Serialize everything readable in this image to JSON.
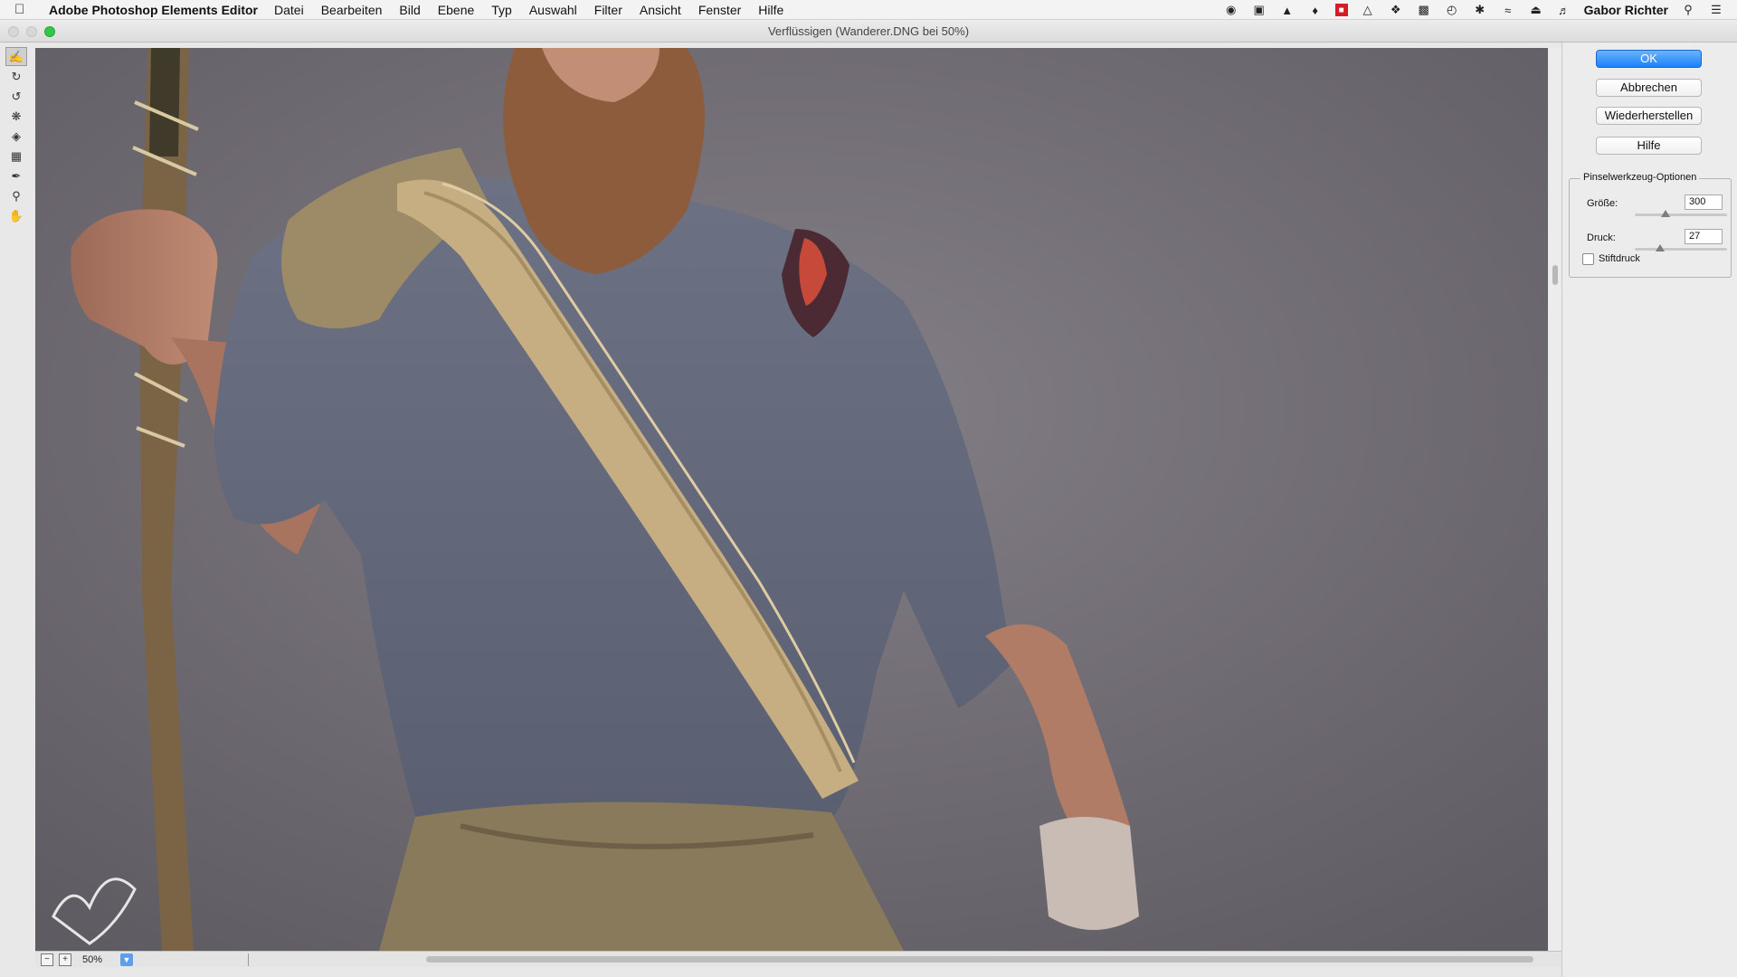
{
  "menubar": {
    "app_name": "Adobe Photoshop Elements Editor",
    "items": [
      "Datei",
      "Bearbeiten",
      "Bild",
      "Ebene",
      "Typ",
      "Auswahl",
      "Filter",
      "Ansicht",
      "Fenster",
      "Hilfe"
    ],
    "user": "Gabor Richter",
    "status_icons": [
      "record-icon",
      "display-icon",
      "airplay-icon",
      "evernote-icon",
      "red-app-icon",
      "drive-icon",
      "dropbox-icon",
      "monitor-icon",
      "time-machine-icon",
      "bluetooth-icon",
      "wifi-icon",
      "eject-icon",
      "volume-icon",
      "spotlight-icon",
      "notification-list-icon"
    ]
  },
  "window": {
    "title": "Verflüssigen (Wanderer.DNG bei 50%)"
  },
  "toolbox": {
    "tools": [
      "warp-tool-icon",
      "twirl-clockwise-icon",
      "twirl-counterclockwise-icon",
      "pucker-tool-icon",
      "bloat-tool-icon",
      "shift-pixels-icon",
      "reconstruct-tool-icon",
      "zoom-tool-icon",
      "hand-tool-icon"
    ]
  },
  "buttons": {
    "ok": "OK",
    "cancel": "Abbrechen",
    "restore": "Wiederherstellen",
    "help": "Hilfe"
  },
  "brush_options": {
    "title": "Pinselwerkzeug-Optionen",
    "size_label": "Größe:",
    "size_value": "300",
    "size_slider": 0.33,
    "pressure_label": "Druck:",
    "pressure_value": "27",
    "pressure_slider": 0.27,
    "stylus_label": "Stiftdruck",
    "stylus_checked": false
  },
  "status": {
    "zoom": "50%"
  },
  "colors": {
    "ok_button": "#1a82fb",
    "backdrop": "#6d6a72"
  }
}
